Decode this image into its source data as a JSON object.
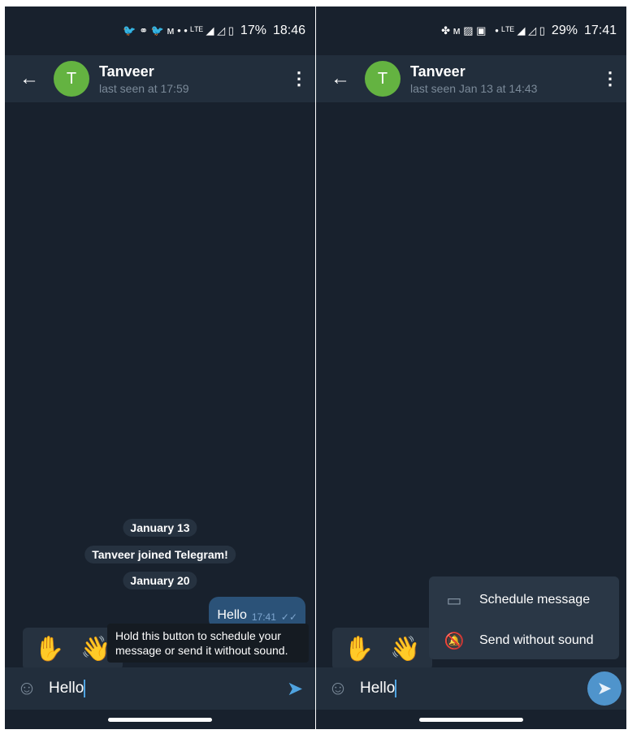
{
  "left": {
    "status": {
      "icons": [
        "twitter-icon",
        "link-icon",
        "twitter-icon",
        "m-icon",
        "dot",
        "dot",
        "lte-icon",
        "signal-icon",
        "roaming-signal-icon",
        "battery-icon"
      ],
      "battery": "17%",
      "time": "18:46"
    },
    "header": {
      "avatar_letter": "T",
      "name": "Tanveer",
      "last_seen": "last seen at 17:59"
    },
    "messages": {
      "date1": "January 13",
      "service": "Tanveer joined Telegram!",
      "date2": "January 20",
      "bubble_text": "Hello",
      "bubble_time": "17:41"
    },
    "emoji_suggestions": [
      "✋",
      "👋"
    ],
    "tooltip": "Hold this button to schedule your message or send it without sound.",
    "input": {
      "value": "Hello"
    }
  },
  "right": {
    "status": {
      "icons": [
        "fan-icon",
        "m-icon",
        "wp-icon",
        "image-icon",
        "dot",
        "lte-icon",
        "signal-icon",
        "roaming-signal-icon",
        "battery-icon"
      ],
      "battery": "29%",
      "time": "17:41"
    },
    "header": {
      "avatar_letter": "T",
      "name": "Tanveer",
      "last_seen": "last seen Jan 13 at 14:43"
    },
    "emoji_suggestions": [
      "✋",
      "👋"
    ],
    "menu": [
      {
        "label": "Schedule message",
        "icon": "calendar-icon"
      },
      {
        "label": "Send without sound",
        "icon": "bell-off-icon"
      }
    ],
    "input": {
      "value": "Hello"
    }
  },
  "colors": {
    "background": "#18212d",
    "header": "#222e3c",
    "bubble": "#2b5278",
    "accent": "#4fa3e0",
    "avatar": "#64b341"
  }
}
